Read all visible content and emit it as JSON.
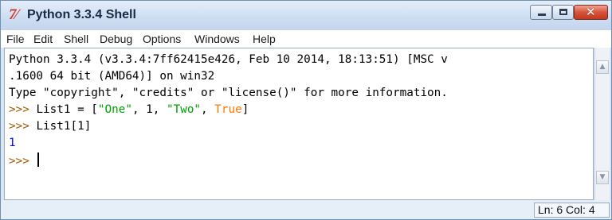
{
  "window": {
    "title": "Python 3.3.4 Shell",
    "icon_glyph": "7⁄",
    "colors": {
      "title_bar": "#cfdff2",
      "close_button": "#c0391f",
      "frame": "#6f8fb3"
    }
  },
  "menu": {
    "items": [
      "File",
      "Edit",
      "Shell",
      "Debug",
      "Options",
      "Windows",
      "Help"
    ]
  },
  "shell": {
    "lines": {
      "banner1": "Python 3.3.4 (v3.3.4:7ff62415e426, Feb 10 2014, 18:13:51) [MSC v",
      "banner2": ".1600 64 bit (AMD64)] on win32",
      "banner3": "Type \"copyright\", \"credits\" or \"license()\" for more information.",
      "prompt": ">>>",
      "cmd1_pre": "List1 = [",
      "cmd1_str1": "\"One\"",
      "cmd1_mid1": ", 1, ",
      "cmd1_str2": "\"Two\"",
      "cmd1_mid2": ", ",
      "cmd1_kw": "True",
      "cmd1_post": "]",
      "cmd2": "List1[1]",
      "output1": "1"
    },
    "syntax_colors": {
      "prompt": "#a05a00",
      "string": "#00a000",
      "keyword": "#ff7700",
      "output": "#0000ff"
    }
  },
  "status": {
    "position": "Ln: 6 Col: 4"
  }
}
